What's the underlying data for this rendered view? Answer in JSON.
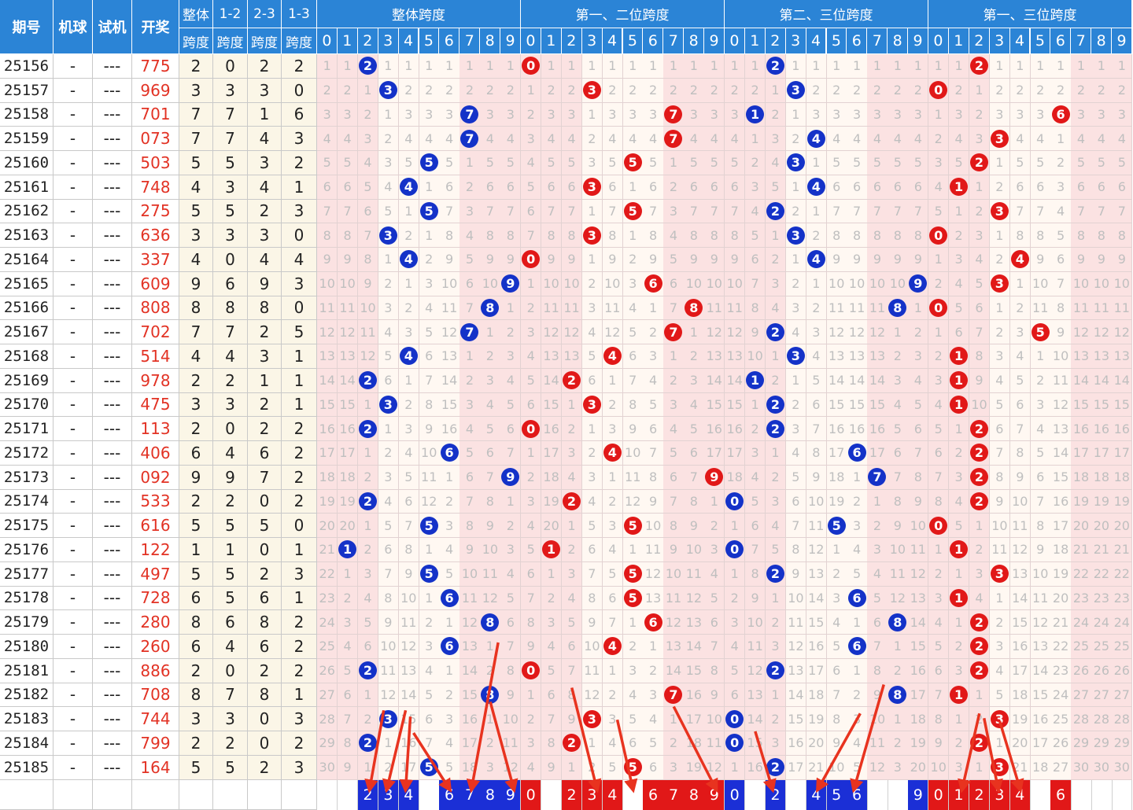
{
  "header": {
    "issue": "期号",
    "machine": "机球",
    "trial": "试机",
    "draw": "开奖",
    "overall_top": "整体",
    "overall_bottom": "跨度",
    "p12_top": "1-2",
    "p23_top": "2-3",
    "p13_top": "1-3",
    "span_bottom": "跨度",
    "groups": [
      "整体跨度",
      "第一、二位跨度",
      "第二、三位跨度",
      "第一、三位跨度"
    ],
    "digits": [
      "0",
      "1",
      "2",
      "3",
      "4",
      "5",
      "6",
      "7",
      "8",
      "9"
    ]
  },
  "colors": {
    "header": "#2b84d6",
    "blue_ball": "#1432c8",
    "red_ball": "#e11818",
    "pink_bg": "#fbe2e2",
    "arrow": "#e8331f",
    "draw_text": "#e23224"
  },
  "chart_data": {
    "type": "table",
    "rows": [
      {
        "issue": "25156",
        "machine": "-",
        "trial": "---",
        "draw": "775",
        "span": 2,
        "s12": 0,
        "s23": 2,
        "s13": 2
      },
      {
        "issue": "25157",
        "machine": "-",
        "trial": "---",
        "draw": "969",
        "span": 3,
        "s12": 3,
        "s23": 3,
        "s13": 0
      },
      {
        "issue": "25158",
        "machine": "-",
        "trial": "---",
        "draw": "701",
        "span": 7,
        "s12": 7,
        "s23": 1,
        "s13": 6
      },
      {
        "issue": "25159",
        "machine": "-",
        "trial": "---",
        "draw": "073",
        "span": 7,
        "s12": 7,
        "s23": 4,
        "s13": 3
      },
      {
        "issue": "25160",
        "machine": "-",
        "trial": "---",
        "draw": "503",
        "span": 5,
        "s12": 5,
        "s23": 3,
        "s13": 2
      },
      {
        "issue": "25161",
        "machine": "-",
        "trial": "---",
        "draw": "748",
        "span": 4,
        "s12": 3,
        "s23": 4,
        "s13": 1
      },
      {
        "issue": "25162",
        "machine": "-",
        "trial": "---",
        "draw": "275",
        "span": 5,
        "s12": 5,
        "s23": 2,
        "s13": 3
      },
      {
        "issue": "25163",
        "machine": "-",
        "trial": "---",
        "draw": "636",
        "span": 3,
        "s12": 3,
        "s23": 3,
        "s13": 0
      },
      {
        "issue": "25164",
        "machine": "-",
        "trial": "---",
        "draw": "337",
        "span": 4,
        "s12": 0,
        "s23": 4,
        "s13": 4
      },
      {
        "issue": "25165",
        "machine": "-",
        "trial": "---",
        "draw": "609",
        "span": 9,
        "s12": 6,
        "s23": 9,
        "s13": 3
      },
      {
        "issue": "25166",
        "machine": "-",
        "trial": "---",
        "draw": "808",
        "span": 8,
        "s12": 8,
        "s23": 8,
        "s13": 0
      },
      {
        "issue": "25167",
        "machine": "-",
        "trial": "---",
        "draw": "702",
        "span": 7,
        "s12": 7,
        "s23": 2,
        "s13": 5
      },
      {
        "issue": "25168",
        "machine": "-",
        "trial": "---",
        "draw": "514",
        "span": 4,
        "s12": 4,
        "s23": 3,
        "s13": 1
      },
      {
        "issue": "25169",
        "machine": "-",
        "trial": "---",
        "draw": "978",
        "span": 2,
        "s12": 2,
        "s23": 1,
        "s13": 1
      },
      {
        "issue": "25170",
        "machine": "-",
        "trial": "---",
        "draw": "475",
        "span": 3,
        "s12": 3,
        "s23": 2,
        "s13": 1
      },
      {
        "issue": "25171",
        "machine": "-",
        "trial": "---",
        "draw": "113",
        "span": 2,
        "s12": 0,
        "s23": 2,
        "s13": 2
      },
      {
        "issue": "25172",
        "machine": "-",
        "trial": "---",
        "draw": "406",
        "span": 6,
        "s12": 4,
        "s23": 6,
        "s13": 2
      },
      {
        "issue": "25173",
        "machine": "-",
        "trial": "---",
        "draw": "092",
        "span": 9,
        "s12": 9,
        "s23": 7,
        "s13": 2
      },
      {
        "issue": "25174",
        "machine": "-",
        "trial": "---",
        "draw": "533",
        "span": 2,
        "s12": 2,
        "s23": 0,
        "s13": 2
      },
      {
        "issue": "25175",
        "machine": "-",
        "trial": "---",
        "draw": "616",
        "span": 5,
        "s12": 5,
        "s23": 5,
        "s13": 0
      },
      {
        "issue": "25176",
        "machine": "-",
        "trial": "---",
        "draw": "122",
        "span": 1,
        "s12": 1,
        "s23": 0,
        "s13": 1
      },
      {
        "issue": "25177",
        "machine": "-",
        "trial": "---",
        "draw": "497",
        "span": 5,
        "s12": 5,
        "s23": 2,
        "s13": 3
      },
      {
        "issue": "25178",
        "machine": "-",
        "trial": "---",
        "draw": "728",
        "span": 6,
        "s12": 5,
        "s23": 6,
        "s13": 1
      },
      {
        "issue": "25179",
        "machine": "-",
        "trial": "---",
        "draw": "280",
        "span": 8,
        "s12": 6,
        "s23": 8,
        "s13": 2
      },
      {
        "issue": "25180",
        "machine": "-",
        "trial": "---",
        "draw": "260",
        "span": 6,
        "s12": 4,
        "s23": 6,
        "s13": 2
      },
      {
        "issue": "25181",
        "machine": "-",
        "trial": "---",
        "draw": "886",
        "span": 2,
        "s12": 0,
        "s23": 2,
        "s13": 2
      },
      {
        "issue": "25182",
        "machine": "-",
        "trial": "---",
        "draw": "708",
        "span": 8,
        "s12": 7,
        "s23": 8,
        "s13": 1
      },
      {
        "issue": "25183",
        "machine": "-",
        "trial": "---",
        "draw": "744",
        "span": 3,
        "s12": 3,
        "s23": 0,
        "s13": 3
      },
      {
        "issue": "25184",
        "machine": "-",
        "trial": "---",
        "draw": "799",
        "span": 2,
        "s12": 2,
        "s23": 0,
        "s13": 2
      },
      {
        "issue": "25185",
        "machine": "-",
        "trial": "---",
        "draw": "164",
        "span": 5,
        "s12": 5,
        "s23": 2,
        "s13": 3
      }
    ],
    "selections": [
      {
        "group": "overall",
        "digits": [
          2,
          3,
          4,
          6,
          7,
          8,
          9
        ]
      },
      {
        "group": "first_second",
        "digits": [
          0,
          2,
          3,
          4,
          6,
          7,
          8,
          9
        ]
      },
      {
        "group": "second_third",
        "digits": [
          0,
          2,
          4,
          5,
          6,
          9
        ]
      },
      {
        "group": "first_third",
        "digits": [
          0,
          1,
          2,
          3,
          4,
          6
        ]
      }
    ]
  }
}
